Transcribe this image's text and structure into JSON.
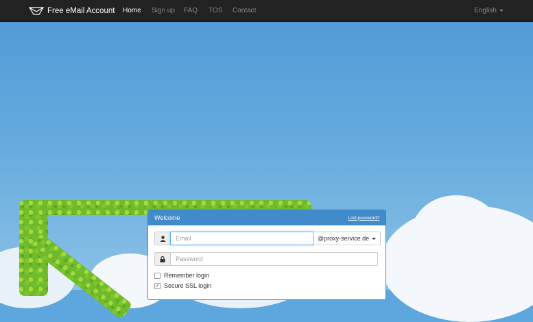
{
  "nav": {
    "brand": "Free eMail Account",
    "links": [
      "Home",
      "Sign up",
      "FAQ",
      "TOS",
      "Contact"
    ],
    "active": "Home",
    "language": "English"
  },
  "login": {
    "title": "Welcome",
    "lost_password": "Lost password?",
    "email_placeholder": "Email",
    "email_value": "",
    "domain": "@proxy-service.de",
    "password_placeholder": "Password",
    "remember_label": "Remember login",
    "remember_checked": false,
    "ssl_label": "Secure SSL login",
    "ssl_checked": true
  },
  "icons": {
    "brand": "envelope-icon",
    "email_addon": "user-icon",
    "password_addon": "lock-icon"
  },
  "colors": {
    "navbar": "#222222",
    "panel_header": "#428bca",
    "sky": "#5ea6de"
  }
}
